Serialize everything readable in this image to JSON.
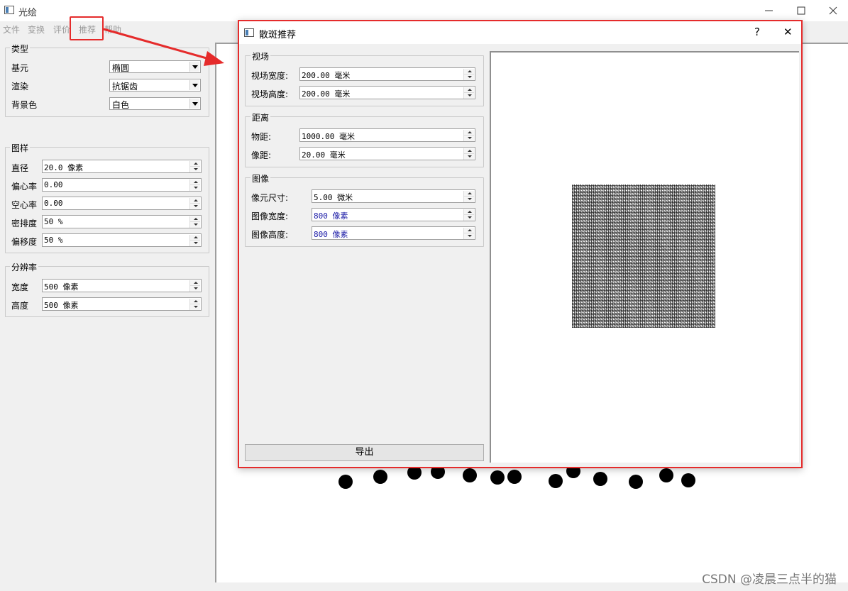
{
  "window": {
    "title": "光绘",
    "min_icon": "minimize-icon",
    "max_icon": "maximize-icon",
    "close_icon": "close-icon"
  },
  "menu": {
    "items": [
      "文件",
      "变换",
      "评价",
      "推荐",
      "帮助"
    ]
  },
  "type_group": {
    "title": "类型",
    "rows": [
      {
        "label": "基元",
        "value": "椭圆"
      },
      {
        "label": "渲染",
        "value": "抗锯齿"
      },
      {
        "label": "背景色",
        "value": "白色"
      }
    ]
  },
  "pattern_group": {
    "title": "图样",
    "rows": [
      {
        "label": "直径",
        "value": "20.0 像素"
      },
      {
        "label": "偏心率",
        "value": "0.00"
      },
      {
        "label": "空心率",
        "value": "0.00"
      },
      {
        "label": "密排度",
        "value": "50 %"
      },
      {
        "label": "偏移度",
        "value": "50 %"
      }
    ]
  },
  "resolution_group": {
    "title": "分辨率",
    "rows": [
      {
        "label": "宽度",
        "value": "500 像素"
      },
      {
        "label": "高度",
        "value": "500 像素"
      }
    ]
  },
  "dialog": {
    "title": "散斑推荐",
    "help": "?",
    "close": "✕",
    "fov_group": {
      "title": "视场",
      "rows": [
        {
          "label": "视场宽度:",
          "value": "200.00 毫米"
        },
        {
          "label": "视场高度:",
          "value": "200.00 毫米"
        }
      ]
    },
    "distance_group": {
      "title": "距离",
      "rows": [
        {
          "label": "物距:",
          "value": "1000.00 毫米"
        },
        {
          "label": "像距:",
          "value": "20.00 毫米"
        }
      ]
    },
    "image_group": {
      "title": "图像",
      "rows": [
        {
          "label": "像元尺寸:",
          "value": "5.00 微米"
        },
        {
          "label": "图像宽度:",
          "value": "800 像素"
        },
        {
          "label": "图像高度:",
          "value": "800 像素"
        }
      ]
    },
    "export_label": "导出"
  },
  "watermark": "CSDN @凌晨三点半的猫",
  "colors": {
    "highlight": "#e52b2b",
    "spin_value_blue": "#1a1aa6"
  }
}
